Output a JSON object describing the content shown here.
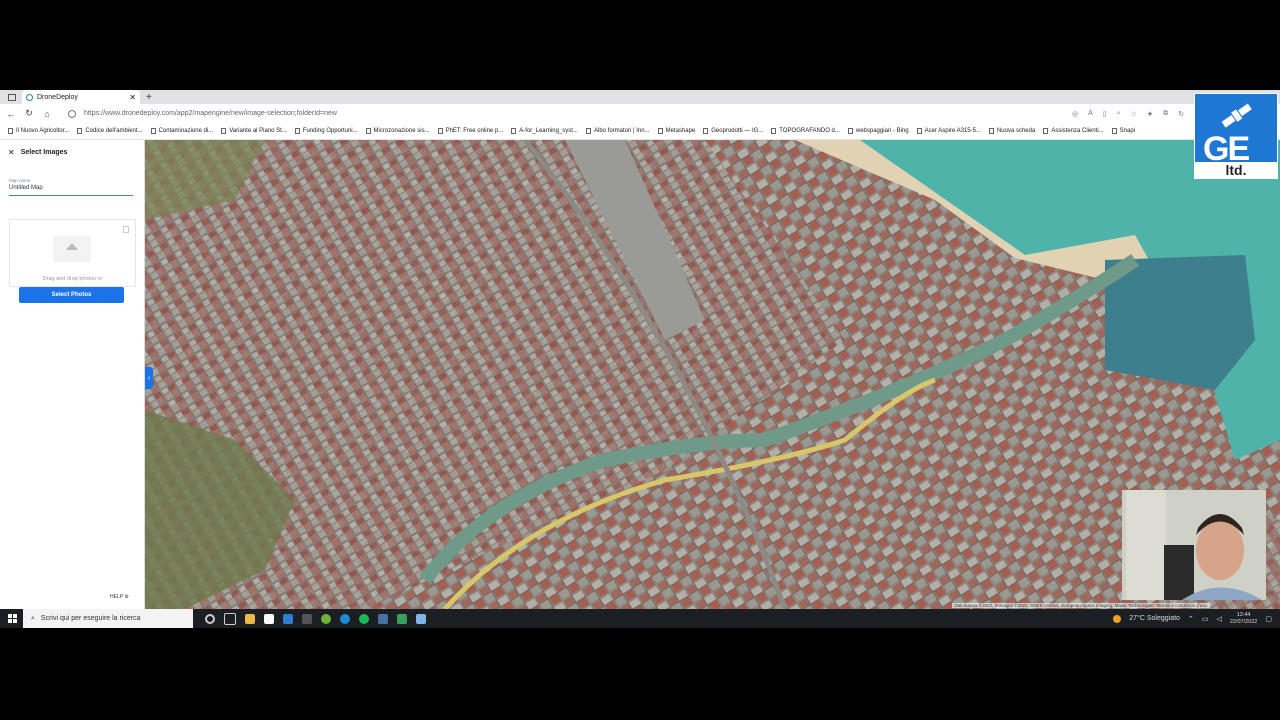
{
  "browser": {
    "tab_title": "DroneDeploy",
    "url": "https://www.dronedeploy.com/app2/mapengine/new/image-selection;folderId=new",
    "bookmarks": [
      "Il Nuovo Agricoltor...",
      "Codice dell'ambient...",
      "Contaminazione di...",
      "Variante al Piano St...",
      "Funding Opportuni...",
      "Microzonazione sis...",
      "PhET: Free online p...",
      "A-for_Learning_syst...",
      "Albo formatori | Inn...",
      "Metashape",
      "Geoprodotti — IG...",
      "TOPOGRAFANDO d...",
      "webspaggiari - Bing",
      "Acer Aspire A315-5...",
      "Nuova scheda",
      "Assistenza Clienti...",
      "Snapi"
    ]
  },
  "sidebar": {
    "title": "Select Images",
    "map_name_label": "Map name",
    "map_name_value": "Untitled Map",
    "drop_text": "Drag and drop photos or",
    "select_button": "Select Photos",
    "help": "HELP"
  },
  "map": {
    "attribution": "Dati mappa ©2022, Immagini ©2022, CNES / Airbus, European Space Imaging, Maxar Technologies   Termini e condizioni d'uso"
  },
  "logo": {
    "text": "GE",
    "subtext": "ltd."
  },
  "taskbar": {
    "search_placeholder": "Scrivi qui per eseguire la ricerca",
    "weather": "27°C  Soleggiato",
    "time": "13:44",
    "date": "22/07/2022"
  },
  "colors": {
    "accent": "#1a73e8",
    "logo_blue": "#1f77d4",
    "sea": "#4fb3a9"
  }
}
